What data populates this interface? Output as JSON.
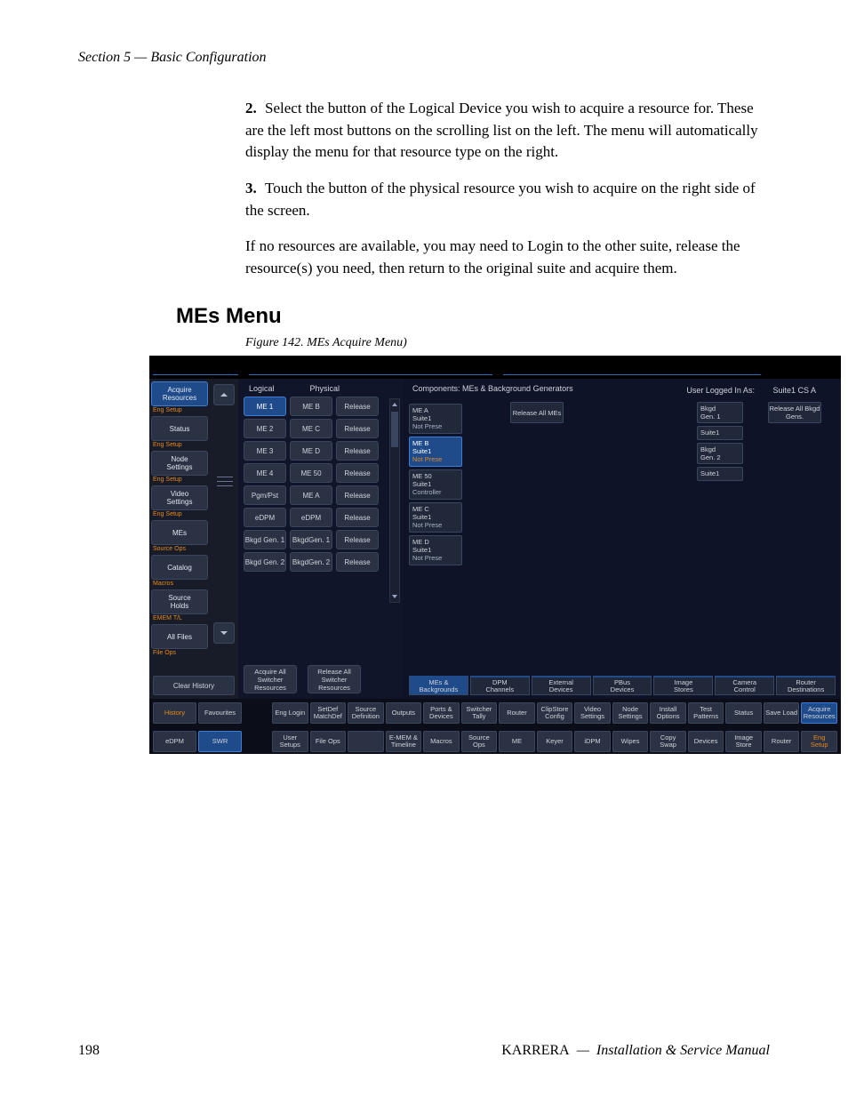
{
  "page": {
    "section_header": "Section 5 — Basic Configuration",
    "page_number": "198",
    "product": "KARRERA",
    "manual": "Installation & Service Manual"
  },
  "steps": {
    "step2_num": "2.",
    "step2": "Select the button of the Logical Device you wish to acquire a resource for. These are the left most buttons on the scrolling list on the left. The menu will automatically display the menu for that resource type on the right.",
    "step3_num": "3.",
    "step3": "Touch the button of the physical resource you wish to acquire on the right side of the screen.",
    "para": "If no resources are available, you may need to Login to the other suite, release the resource(s) you need, then return to the original suite and acquire them."
  },
  "heading": "MEs Menu",
  "figure_caption": "Figure 142.  MEs Acquire Menu)",
  "sidebar": {
    "items": [
      {
        "label": "Acquire\nResources",
        "sub": "Eng Setup",
        "selected": true
      },
      {
        "label": "Status",
        "sub": "Eng Setup"
      },
      {
        "label": "Node\nSettings",
        "sub": "Eng Setup"
      },
      {
        "label": "Video\nSettings",
        "sub": "Eng Setup"
      },
      {
        "label": "MEs",
        "sub": "Source Ops"
      },
      {
        "label": "Catalog",
        "sub": "Macros"
      },
      {
        "label": "Source\nHolds",
        "sub": "EMEM T/L"
      },
      {
        "label": "All Files",
        "sub": "File Ops"
      }
    ],
    "clear_history": "Clear History"
  },
  "mid": {
    "headers": {
      "logical": "Logical",
      "physical": "Physical"
    },
    "rows": [
      {
        "logical": "ME 1",
        "physical": "ME B",
        "release": "Release",
        "selected": true
      },
      {
        "logical": "ME 2",
        "physical": "ME C",
        "release": "Release"
      },
      {
        "logical": "ME 3",
        "physical": "ME D",
        "release": "Release"
      },
      {
        "logical": "ME 4",
        "physical": "ME 50",
        "release": "Release"
      },
      {
        "logical": "Pgm/Pst",
        "physical": "ME A",
        "release": "Release"
      },
      {
        "logical": "eDPM",
        "physical": "eDPM",
        "release": "Release"
      },
      {
        "logical": "Bkgd Gen. 1",
        "physical": "BkgdGen. 1",
        "release": "Release"
      },
      {
        "logical": "Bkgd Gen. 2",
        "physical": "BkgdGen. 2",
        "release": "Release"
      }
    ],
    "acquire_all": "Acquire All\nSwitcher\nResources",
    "release_all": "Release All\nSwitcher\nResources"
  },
  "right": {
    "components_label": "Components: MEs & Background Generators",
    "logged_in_label": "User Logged In As:",
    "logged_in_value": "Suite1  CS A",
    "release_all_mes": "Release All\nMEs",
    "release_all_bkgd": "Release All\nBkgd Gens.",
    "me_tiles": [
      {
        "l1": "ME A",
        "l2": "Suite1",
        "l3": "Not Prese"
      },
      {
        "l1": "ME B",
        "l2": "Suite1",
        "l3": "Not Prese",
        "selected": true
      },
      {
        "l1": "ME 50",
        "l2": "Suite1",
        "l3": "Controller"
      },
      {
        "l1": "ME C",
        "l2": "Suite1",
        "l3": "Not Prese"
      },
      {
        "l1": "ME D",
        "l2": "Suite1",
        "l3": "Not Prese"
      }
    ],
    "bk_tiles": [
      {
        "l1": "Bkgd\nGen. 1",
        "l2": "Suite1"
      },
      {
        "l1": "Bkgd\nGen. 2",
        "l2": "Suite1"
      }
    ],
    "category_tabs": [
      {
        "label": "MEs &\nBackgrounds",
        "selected": true
      },
      {
        "label": "DPM\nChannels"
      },
      {
        "label": "External\nDevices"
      },
      {
        "label": "PBus\nDevices"
      },
      {
        "label": "Image\nStores"
      },
      {
        "label": "Camera\nControl"
      },
      {
        "label": "Router\nDestinations"
      }
    ]
  },
  "bottomnav1": {
    "left": {
      "history": "History",
      "favourites": "Favourites"
    },
    "items": [
      {
        "label": "Eng Login"
      },
      {
        "label": "SetDef\nMatchDef"
      },
      {
        "label": "Source\nDefinition"
      },
      {
        "label": "Outputs"
      },
      {
        "label": "Ports &\nDevices"
      },
      {
        "label": "Switcher\nTally"
      },
      {
        "label": "Router"
      },
      {
        "label": "ClipStore\nConfig"
      },
      {
        "label": "Video\nSettings"
      },
      {
        "label": "Node\nSettings"
      },
      {
        "label": "Install\nOptions"
      },
      {
        "label": "Test\nPatterns"
      },
      {
        "label": "Status"
      },
      {
        "label": "Save Load"
      },
      {
        "label": "Acquire\nResources",
        "selected": true
      }
    ]
  },
  "bottomnav2": {
    "left": {
      "edpm": "eDPM",
      "swr": "SWR"
    },
    "items": [
      {
        "label": "User\nSetups"
      },
      {
        "label": "File Ops"
      },
      {
        "label": "",
        "empty": true
      },
      {
        "label": "E-MEM &\nTimeline"
      },
      {
        "label": "Macros"
      },
      {
        "label": "Source\nOps"
      },
      {
        "label": "ME"
      },
      {
        "label": "Keyer"
      },
      {
        "label": "iDPM"
      },
      {
        "label": "Wipes"
      },
      {
        "label": "Copy\nSwap"
      },
      {
        "label": "Devices"
      },
      {
        "label": "Image\nStore"
      },
      {
        "label": "Router"
      },
      {
        "label": "Eng\nSetup",
        "orange": true
      }
    ]
  }
}
